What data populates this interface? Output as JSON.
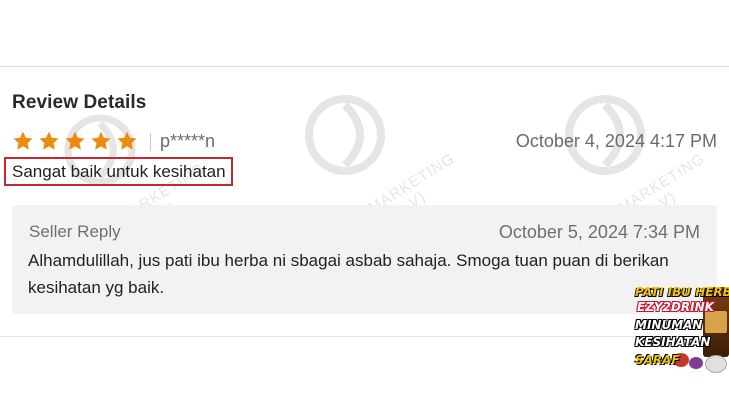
{
  "review": {
    "section_title": "Review Details",
    "rating": 5,
    "max_rating": 5,
    "star_color": "#ee8a10",
    "username": "p*****n",
    "date": "October 4, 2024 4:17 PM",
    "text": "Sangat baik untuk kesihatan"
  },
  "reply": {
    "label": "Seller Reply",
    "date": "October 5, 2024 7:34 PM",
    "text": "Alhamdulillah, jus pati ibu herba ni sbagai asbab sahaja. Smoga tuan puan di berikan kesihatan yg baik."
  },
  "watermark": {
    "line1": "RASZQ MARKETING",
    "line2": "(KT0525269-V)"
  },
  "ad_badge": {
    "lines": [
      "PATI IBU HERBA",
      "EZY2DRINK",
      "MINUMAN",
      "KESIHATAN",
      "SARAF"
    ]
  },
  "colors": {
    "highlight_border": "#c8282b",
    "reply_bg": "#f2f2f2"
  }
}
